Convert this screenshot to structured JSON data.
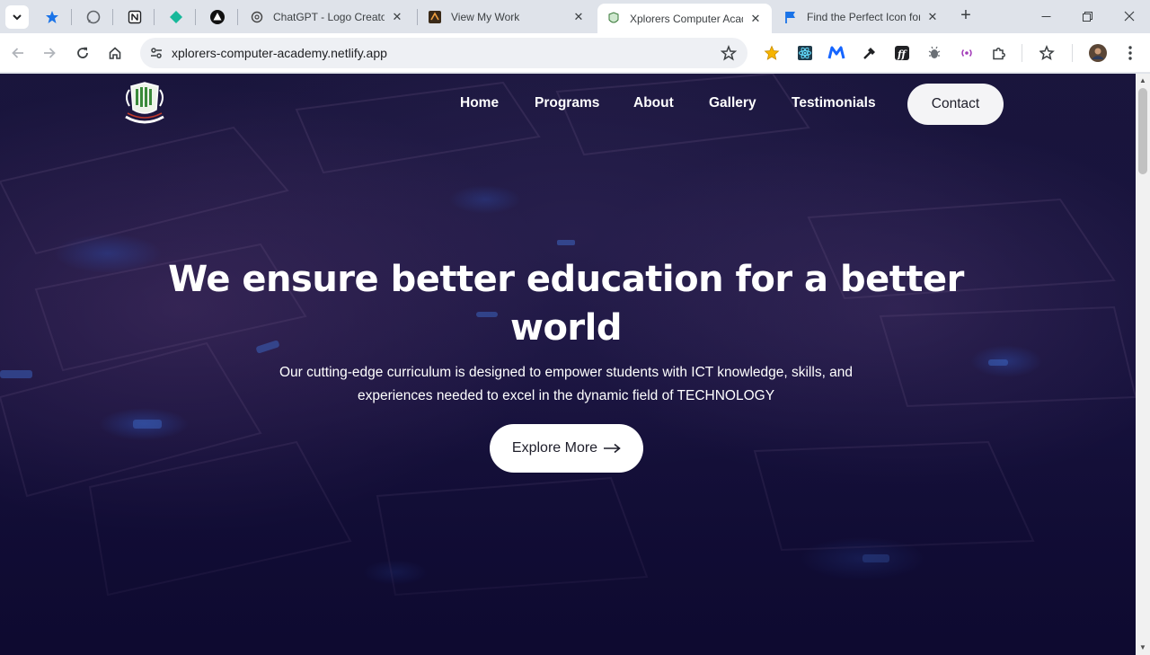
{
  "browser": {
    "tabs": [
      {
        "title": "ChatGPT - Logo Creator",
        "close": "✕"
      },
      {
        "title": "View My Work",
        "close": "✕"
      },
      {
        "title": "Xplorers Computer Acad",
        "close": "✕",
        "active": true
      },
      {
        "title": "Find the Perfect Icon for",
        "close": "✕"
      }
    ],
    "new_tab": "+",
    "url": "xplorers-computer-academy.netlify.app",
    "window_controls": {
      "minimize": "—",
      "restore": "❐",
      "close": "✕"
    }
  },
  "site": {
    "nav": {
      "home": "Home",
      "programs": "Programs",
      "about": "About",
      "gallery": "Gallery",
      "testimonials": "Testimonials",
      "contact": "Contact"
    },
    "hero": {
      "headline_line1": "We ensure better education for a better",
      "headline_line2": "world",
      "sub_line1": "Our cutting-edge curriculum is designed to empower students with ICT knowledge, skills, and",
      "sub_line2": "experiences needed to excel in the dynamic field of TECHNOLOGY",
      "cta": "Explore More",
      "cta_arrow": "⟶"
    }
  },
  "colors": {
    "page_bg": "#1b1642",
    "button_bg": "#f4f4f6",
    "accent_blue": "#3c78ff"
  }
}
